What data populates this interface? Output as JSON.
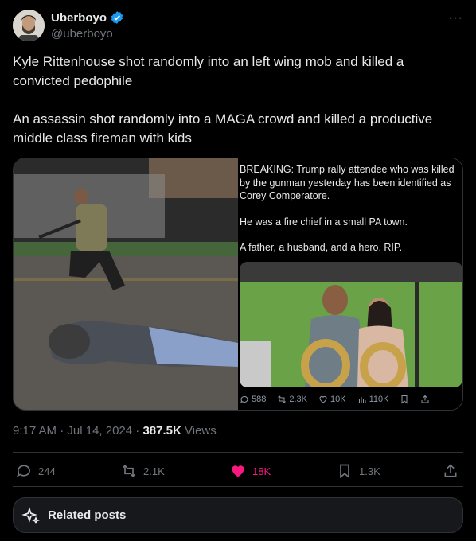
{
  "author": {
    "name": "Uberboyo",
    "handle": "@uberboyo",
    "verified_color": "#1d9bf0"
  },
  "tweet": {
    "paragraph1": "Kyle Rittenhouse shot randomly into an left wing mob and killed a convicted pedophile",
    "paragraph2": "An assassin shot randomly into a MAGA crowd and killed a productive middle class fireman with kids"
  },
  "embedded_screenshot": {
    "line1": "BREAKING: Trump rally attendee who was killed by the gunman yesterday has been identified as Corey Comperatore.",
    "line2": "He was a fire chief in a small PA town.",
    "line3": "A father, a husband, and a hero. RIP.",
    "metrics": {
      "replies": "588",
      "reposts": "2.3K",
      "likes": "10K",
      "views": "110K"
    }
  },
  "meta": {
    "time": "9:17 AM",
    "separator": " · ",
    "date": "Jul 14, 2024",
    "views_count": "387.5K",
    "views_label": " Views"
  },
  "actions": {
    "replies": "244",
    "reposts": "2.1K",
    "likes": "18K",
    "bookmarks": "1.3K",
    "like_color": "#f91880"
  },
  "related": {
    "label": "Related posts"
  }
}
